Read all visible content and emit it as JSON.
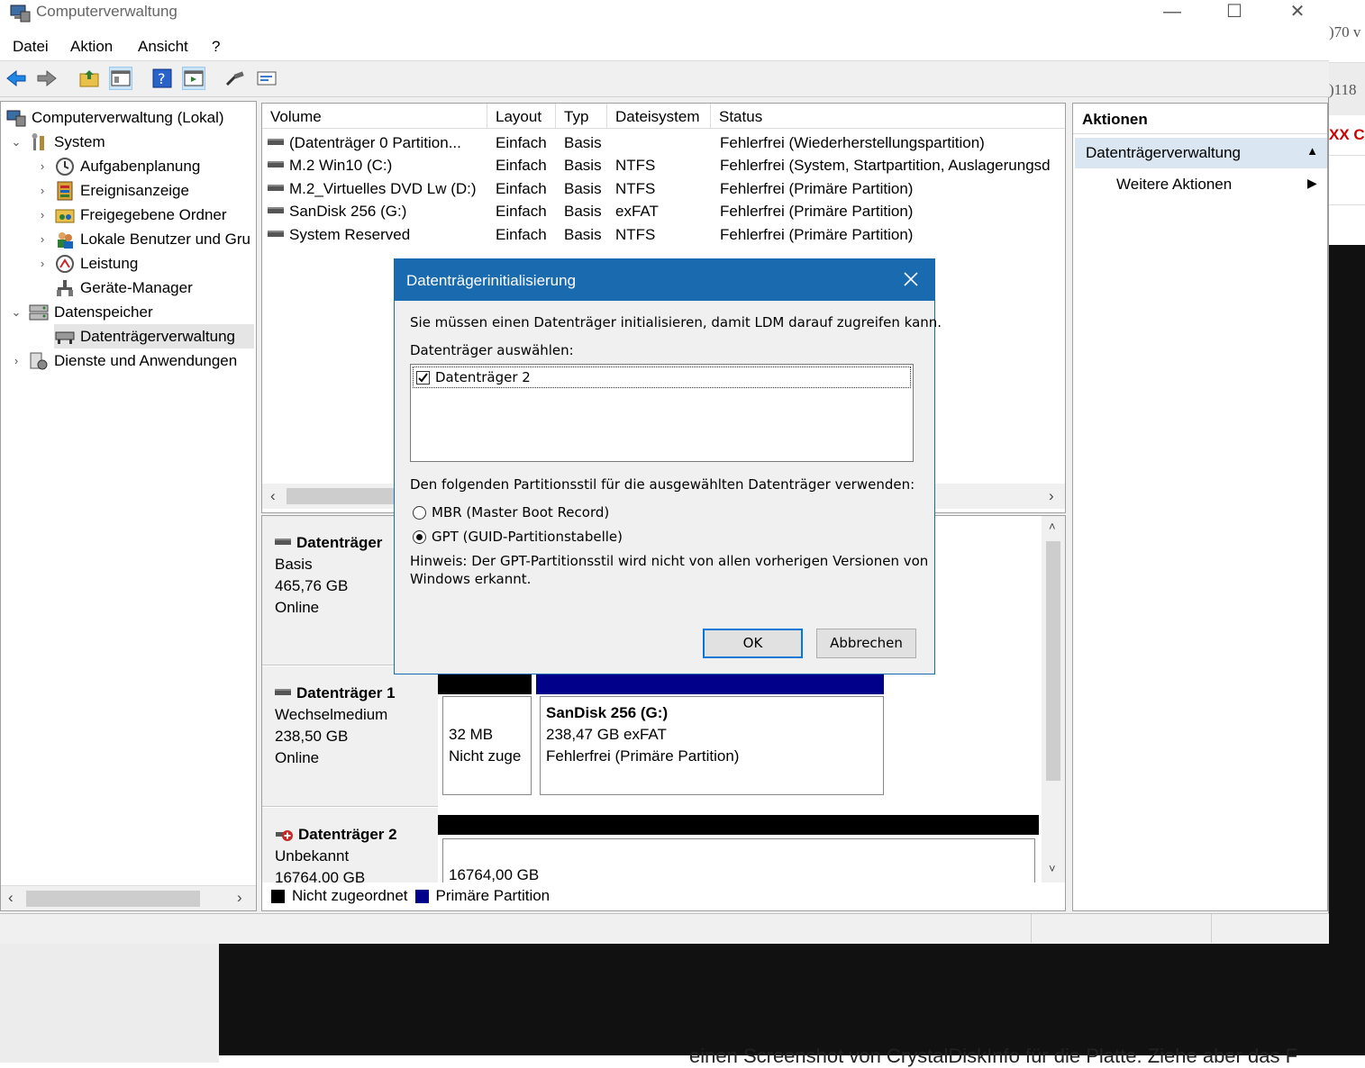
{
  "window": {
    "title": "Computerverwaltung"
  },
  "menu": [
    "Datei",
    "Aktion",
    "Ansicht",
    "?"
  ],
  "tree": {
    "items": [
      {
        "label": "Computerverwaltung (Lokal)",
        "icon": "computer-management-icon"
      },
      {
        "label": "System",
        "icon": "tools-icon"
      },
      {
        "label": "Aufgabenplanung",
        "icon": "clock-icon"
      },
      {
        "label": "Ereignisanzeige",
        "icon": "event-viewer-icon"
      },
      {
        "label": "Freigegebene Ordner",
        "icon": "shared-folder-icon"
      },
      {
        "label": "Lokale Benutzer und Gru",
        "icon": "users-icon"
      },
      {
        "label": "Leistung",
        "icon": "performance-icon"
      },
      {
        "label": "Geräte-Manager",
        "icon": "device-manager-icon"
      },
      {
        "label": "Datenspeicher",
        "icon": "storage-icon"
      },
      {
        "label": "Datenträgerverwaltung",
        "icon": "disk-management-icon"
      },
      {
        "label": "Dienste und Anwendungen",
        "icon": "services-icon"
      }
    ]
  },
  "list": {
    "columns": [
      "Volume",
      "Layout",
      "Typ",
      "Dateisystem",
      "Status"
    ],
    "rows": [
      {
        "volume": "(Datenträger 0 Partition...",
        "layout": "Einfach",
        "typ": "Basis",
        "fs": "",
        "status": "Fehlerfrei (Wiederherstellungspartition)"
      },
      {
        "volume": "M.2 Win10 (C:)",
        "layout": "Einfach",
        "typ": "Basis",
        "fs": "NTFS",
        "status": "Fehlerfrei (System, Startpartition, Auslagerungsd"
      },
      {
        "volume": "M.2_Virtuelles DVD Lw (D:)",
        "layout": "Einfach",
        "typ": "Basis",
        "fs": "NTFS",
        "status": "Fehlerfrei (Primäre Partition)"
      },
      {
        "volume": "SanDisk 256 (G:)",
        "layout": "Einfach",
        "typ": "Basis",
        "fs": "exFAT",
        "status": "Fehlerfrei (Primäre Partition)"
      },
      {
        "volume": "System Reserved",
        "layout": "Einfach",
        "typ": "Basis",
        "fs": "NTFS",
        "status": "Fehlerfrei (Primäre Partition)"
      }
    ]
  },
  "disks": [
    {
      "name": "Datenträger",
      "type": "Basis",
      "size": "465,76 GB",
      "state": "Online"
    },
    {
      "name": "Datenträger 1",
      "type": "Wechselmedium",
      "size": "238,50 GB",
      "state": "Online",
      "unalloc_size": "32 MB",
      "unalloc_label": "Nicht zuge",
      "part_name": "SanDisk 256  (G:)",
      "part_size": "238,47 GB exFAT",
      "part_status": "Fehlerfrei (Primäre Partition)"
    },
    {
      "name": "Datenträger 2",
      "type": "Unbekannt",
      "size": "16764,00 GB",
      "part_size": "16764,00 GB"
    }
  ],
  "legend": [
    {
      "label": "Nicht zugeordnet",
      "color": "#000000"
    },
    {
      "label": "Primäre Partition",
      "color": "#00008b"
    }
  ],
  "actions": {
    "header": "Aktionen",
    "selected": "Datenträgerverwaltung",
    "more": "Weitere Aktionen"
  },
  "dialog": {
    "title": "Datenträgerinitialisierung",
    "intro": "Sie müssen einen Datenträger initialisieren, damit LDM darauf zugreifen kann.",
    "select_label": "Datenträger auswählen:",
    "disk_item": "Datenträger 2",
    "style_label": "Den folgenden Partitionsstil für die ausgewählten Datenträger verwenden:",
    "mbr": "MBR (Master Boot Record)",
    "gpt": "GPT (GUID-Partitionstabelle)",
    "hint_line1": "Hinweis: Der GPT-Partitionsstil wird nicht von allen vorherigen Versionen von",
    "hint_line2": "Windows erkannt.",
    "ok": "OK",
    "cancel": "Abbrechen"
  },
  "background": {
    "right_texts": [
      ")70 v",
      ")118"
    ],
    "right_brand": "XX C",
    "bottom_text": "einen Screenshot von CrystalDiskInfo für die Platte. Ziehe aber das F"
  },
  "colors": {
    "accent": "#1a6ab0",
    "unallocated": "#000000",
    "primary": "#00008b",
    "selection": "#dae6f2"
  }
}
